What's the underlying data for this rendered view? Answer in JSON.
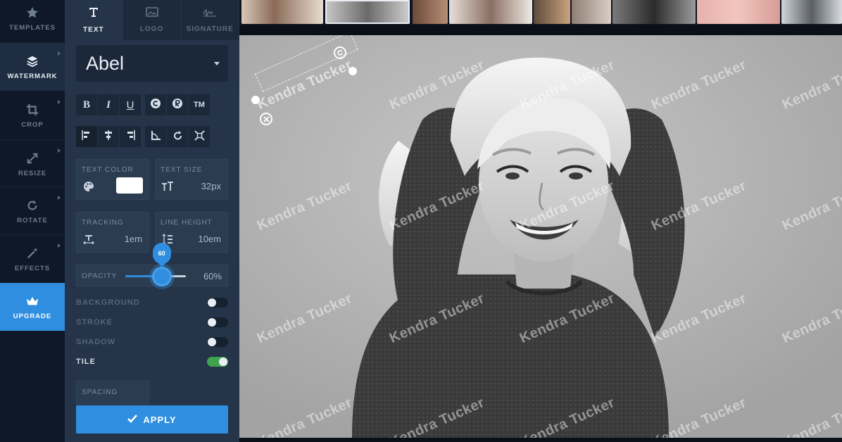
{
  "rail": {
    "items": [
      {
        "label": "TEMPLATES",
        "icon": "star-icon"
      },
      {
        "label": "WATERMARK",
        "icon": "layers-icon"
      },
      {
        "label": "CROP",
        "icon": "crop-icon"
      },
      {
        "label": "RESIZE",
        "icon": "resize-icon"
      },
      {
        "label": "ROTATE",
        "icon": "rotate-icon"
      },
      {
        "label": "EFFECTS",
        "icon": "magic-wand-icon"
      },
      {
        "label": "UPGRADE",
        "icon": "crown-icon"
      }
    ]
  },
  "tabs": [
    {
      "label": "TEXT",
      "icon": "text-icon"
    },
    {
      "label": "LOGO",
      "icon": "image-icon"
    },
    {
      "label": "SIGNATURE",
      "icon": "signature-icon"
    }
  ],
  "font": {
    "selected": "Abel"
  },
  "format_buttons": {
    "bold": "B",
    "italic": "I",
    "underline": "U",
    "trademark": "TM"
  },
  "text_color": {
    "label": "TEXT COLOR",
    "value": "#ffffff"
  },
  "text_size": {
    "label": "TEXT SIZE",
    "value": "32px"
  },
  "tracking": {
    "label": "TRACKING",
    "value": "1em"
  },
  "line_height": {
    "label": "LINE HEIGHT",
    "value": "10em"
  },
  "opacity": {
    "label": "OPACITY",
    "value": "60%",
    "bubble": "60",
    "level": 0.6
  },
  "toggles": [
    {
      "label": "BACKGROUND",
      "on": false
    },
    {
      "label": "STROKE",
      "on": false
    },
    {
      "label": "SHADOW",
      "on": false
    },
    {
      "label": "TILE",
      "on": true
    }
  ],
  "spacing": {
    "label": "SPACING"
  },
  "apply": {
    "label": "APPLY"
  },
  "watermark": {
    "text": "Kendra Tucker"
  },
  "colors": {
    "accent": "#2f8ee0",
    "toggle_on": "#3fa34d"
  }
}
